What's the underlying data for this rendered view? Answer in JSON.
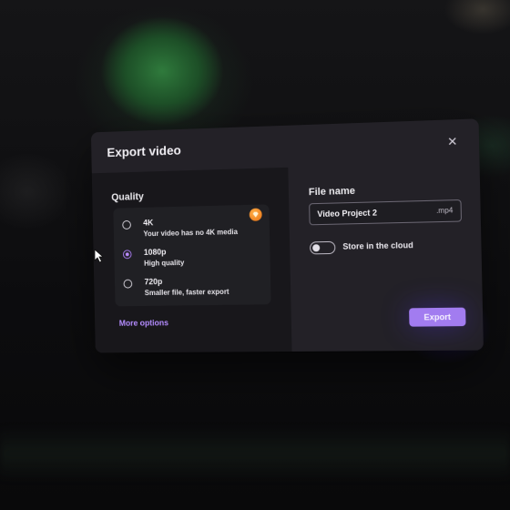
{
  "dialog": {
    "title": "Export video",
    "close_icon": "close-icon"
  },
  "quality": {
    "label": "Quality",
    "options": [
      {
        "title": "4K",
        "subtitle": "Your video has no 4K media",
        "selected": false,
        "badge_icon": "premium-gem-icon"
      },
      {
        "title": "1080p",
        "subtitle": "High quality",
        "selected": true
      },
      {
        "title": "720p",
        "subtitle": "Smaller file, faster export",
        "selected": false
      }
    ],
    "more_options": "More options"
  },
  "file": {
    "label": "File name",
    "value": "Video Project 2",
    "extension": ".mp4"
  },
  "cloud": {
    "label": "Store in the cloud",
    "enabled": false
  },
  "actions": {
    "export": "Export"
  },
  "colors": {
    "accent": "#a27cf0",
    "link": "#b48cff",
    "badge": "#f08a1c"
  }
}
